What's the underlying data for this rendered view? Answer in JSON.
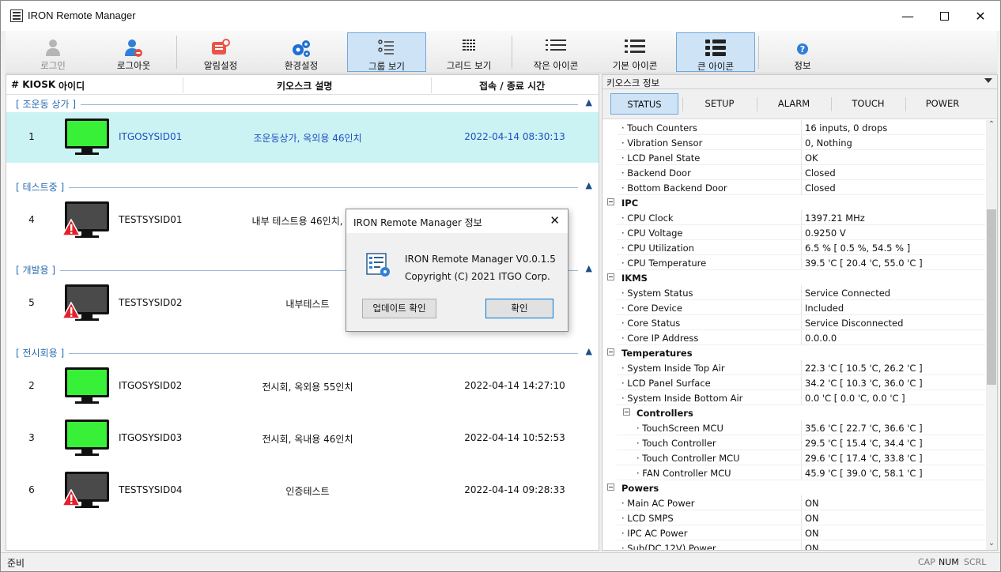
{
  "window": {
    "title": "IRON Remote Manager"
  },
  "toolbar": {
    "login": "로그인",
    "logout": "로그아웃",
    "alarm_settings": "알림설정",
    "env_settings": "환경설정",
    "group_view": "그룹 보기",
    "grid_view": "그리드 보기",
    "small_icons": "작은 아이콘",
    "basic_icons": "기본 아이콘",
    "large_icons": "큰 아이콘",
    "info": "정보"
  },
  "list": {
    "headers": {
      "num": "# KIOSK",
      "id": "아이디",
      "desc": "키오스크 설명",
      "time": "접속 / 종료 시간"
    },
    "groups": [
      {
        "name": "[ 조운동 상가 ]",
        "rows": [
          {
            "num": "1",
            "id": "ITGOSYSID01",
            "desc": "조운동상가, 옥외용 46인치",
            "time": "2022-04-14 08:30:13",
            "status": "online",
            "selected": true
          }
        ]
      },
      {
        "name": "[ 테스트중 ]",
        "rows": [
          {
            "num": "4",
            "id": "TESTSYSID01",
            "desc": "내부 테스트용 46인치, 이전",
            "time": "",
            "status": "warning",
            "selected": false
          }
        ]
      },
      {
        "name": "[ 개발용 ]",
        "rows": [
          {
            "num": "5",
            "id": "TESTSYSID02",
            "desc": "내부테스트",
            "time": "",
            "status": "warning",
            "selected": false
          }
        ]
      },
      {
        "name": "[ 전시회용 ]",
        "rows": [
          {
            "num": "2",
            "id": "ITGOSYSID02",
            "desc": "전시회, 옥외용 55인치",
            "time": "2022-04-14 14:27:10",
            "status": "online",
            "selected": false
          },
          {
            "num": "3",
            "id": "ITGOSYSID03",
            "desc": "전시회, 옥내용 46인치",
            "time": "2022-04-14 10:52:53",
            "status": "online",
            "selected": false
          },
          {
            "num": "6",
            "id": "TESTSYSID04",
            "desc": "인증테스트",
            "time": "2022-04-14 09:28:33",
            "status": "warning",
            "selected": false
          }
        ]
      }
    ]
  },
  "info_panel": {
    "title": "키오스크 정보",
    "tabs": [
      "STATUS",
      "SETUP",
      "ALARM",
      "TOUCH",
      "POWER"
    ],
    "active_tab": "STATUS",
    "rows": [
      {
        "type": "prop",
        "key": "Touch Counters",
        "value": "16 inputs, 0 drops"
      },
      {
        "type": "prop",
        "key": "Vibration Sensor",
        "value": "0, Nothing"
      },
      {
        "type": "prop",
        "key": "LCD Panel State",
        "value": "OK"
      },
      {
        "type": "prop",
        "key": "Backend Door",
        "value": "Closed"
      },
      {
        "type": "prop",
        "key": "Bottom Backend Door",
        "value": "Closed"
      },
      {
        "type": "cat",
        "key": "IPC"
      },
      {
        "type": "prop",
        "key": "CPU Clock",
        "value": "1397.21 MHz"
      },
      {
        "type": "prop",
        "key": "CPU Voltage",
        "value": "0.9250 V"
      },
      {
        "type": "prop",
        "key": "CPU Utilization",
        "value": "6.5 %  [ 0.5 %, 54.5 % ]"
      },
      {
        "type": "prop",
        "key": "CPU Temperature",
        "value": "39.5 'C  [ 20.4 'C, 55.0 'C ]"
      },
      {
        "type": "cat",
        "key": "IKMS"
      },
      {
        "type": "prop",
        "key": "System Status",
        "value": "Service Connected"
      },
      {
        "type": "prop",
        "key": "Core Device",
        "value": "Included"
      },
      {
        "type": "prop",
        "key": "Core Status",
        "value": "Service Disconnected"
      },
      {
        "type": "prop",
        "key": "Core IP Address",
        "value": "0.0.0.0"
      },
      {
        "type": "cat",
        "key": "Temperatures"
      },
      {
        "type": "prop",
        "key": "System Inside Top Air",
        "value": "22.3 'C  [ 10.5 'C, 26.2 'C ]"
      },
      {
        "type": "prop",
        "key": "LCD Panel Surface",
        "value": "34.2 'C  [ 10.3 'C, 36.0 'C ]"
      },
      {
        "type": "prop",
        "key": "System Inside Bottom Air",
        "value": "0.0 'C  [ 0.0 'C, 0.0 'C ]"
      },
      {
        "type": "subcat",
        "key": "Controllers"
      },
      {
        "type": "subprop",
        "key": "TouchScreen MCU",
        "value": "35.6 'C  [ 22.7 'C, 36.6 'C ]"
      },
      {
        "type": "subprop",
        "key": "Touch Controller",
        "value": "29.5 'C  [ 15.4 'C, 34.4 'C ]"
      },
      {
        "type": "subprop",
        "key": "Touch Controller MCU",
        "value": "29.6 'C  [ 17.4 'C, 33.8 'C ]"
      },
      {
        "type": "subprop",
        "key": "FAN Controller MCU",
        "value": "45.9 'C  [ 39.0 'C, 58.1 'C ]"
      },
      {
        "type": "cat",
        "key": "Powers"
      },
      {
        "type": "prop",
        "key": "Main AC Power",
        "value": "ON"
      },
      {
        "type": "prop",
        "key": "LCD SMPS",
        "value": "ON"
      },
      {
        "type": "prop",
        "key": "IPC AC Power",
        "value": "ON"
      },
      {
        "type": "prop",
        "key": "Sub(DC 12V) Power",
        "value": "ON"
      }
    ]
  },
  "dialog": {
    "title": "IRON Remote Manager 정보",
    "line1": "IRON Remote Manager V0.0.1.5",
    "line2": "Copyright (C) 2021 ITGO Corp.",
    "update_button": "업데이트 확인",
    "ok_button": "확인"
  },
  "statusbar": {
    "ready": "준비",
    "cap": "CAP",
    "num": "NUM",
    "scrl": "SCRL"
  },
  "colors": {
    "online": "#37f037",
    "offline": "#4a4a4a",
    "selected_row": "#ccf3f3",
    "group_text": "#2b6cb0",
    "active_tab": "#cfe3f6"
  }
}
